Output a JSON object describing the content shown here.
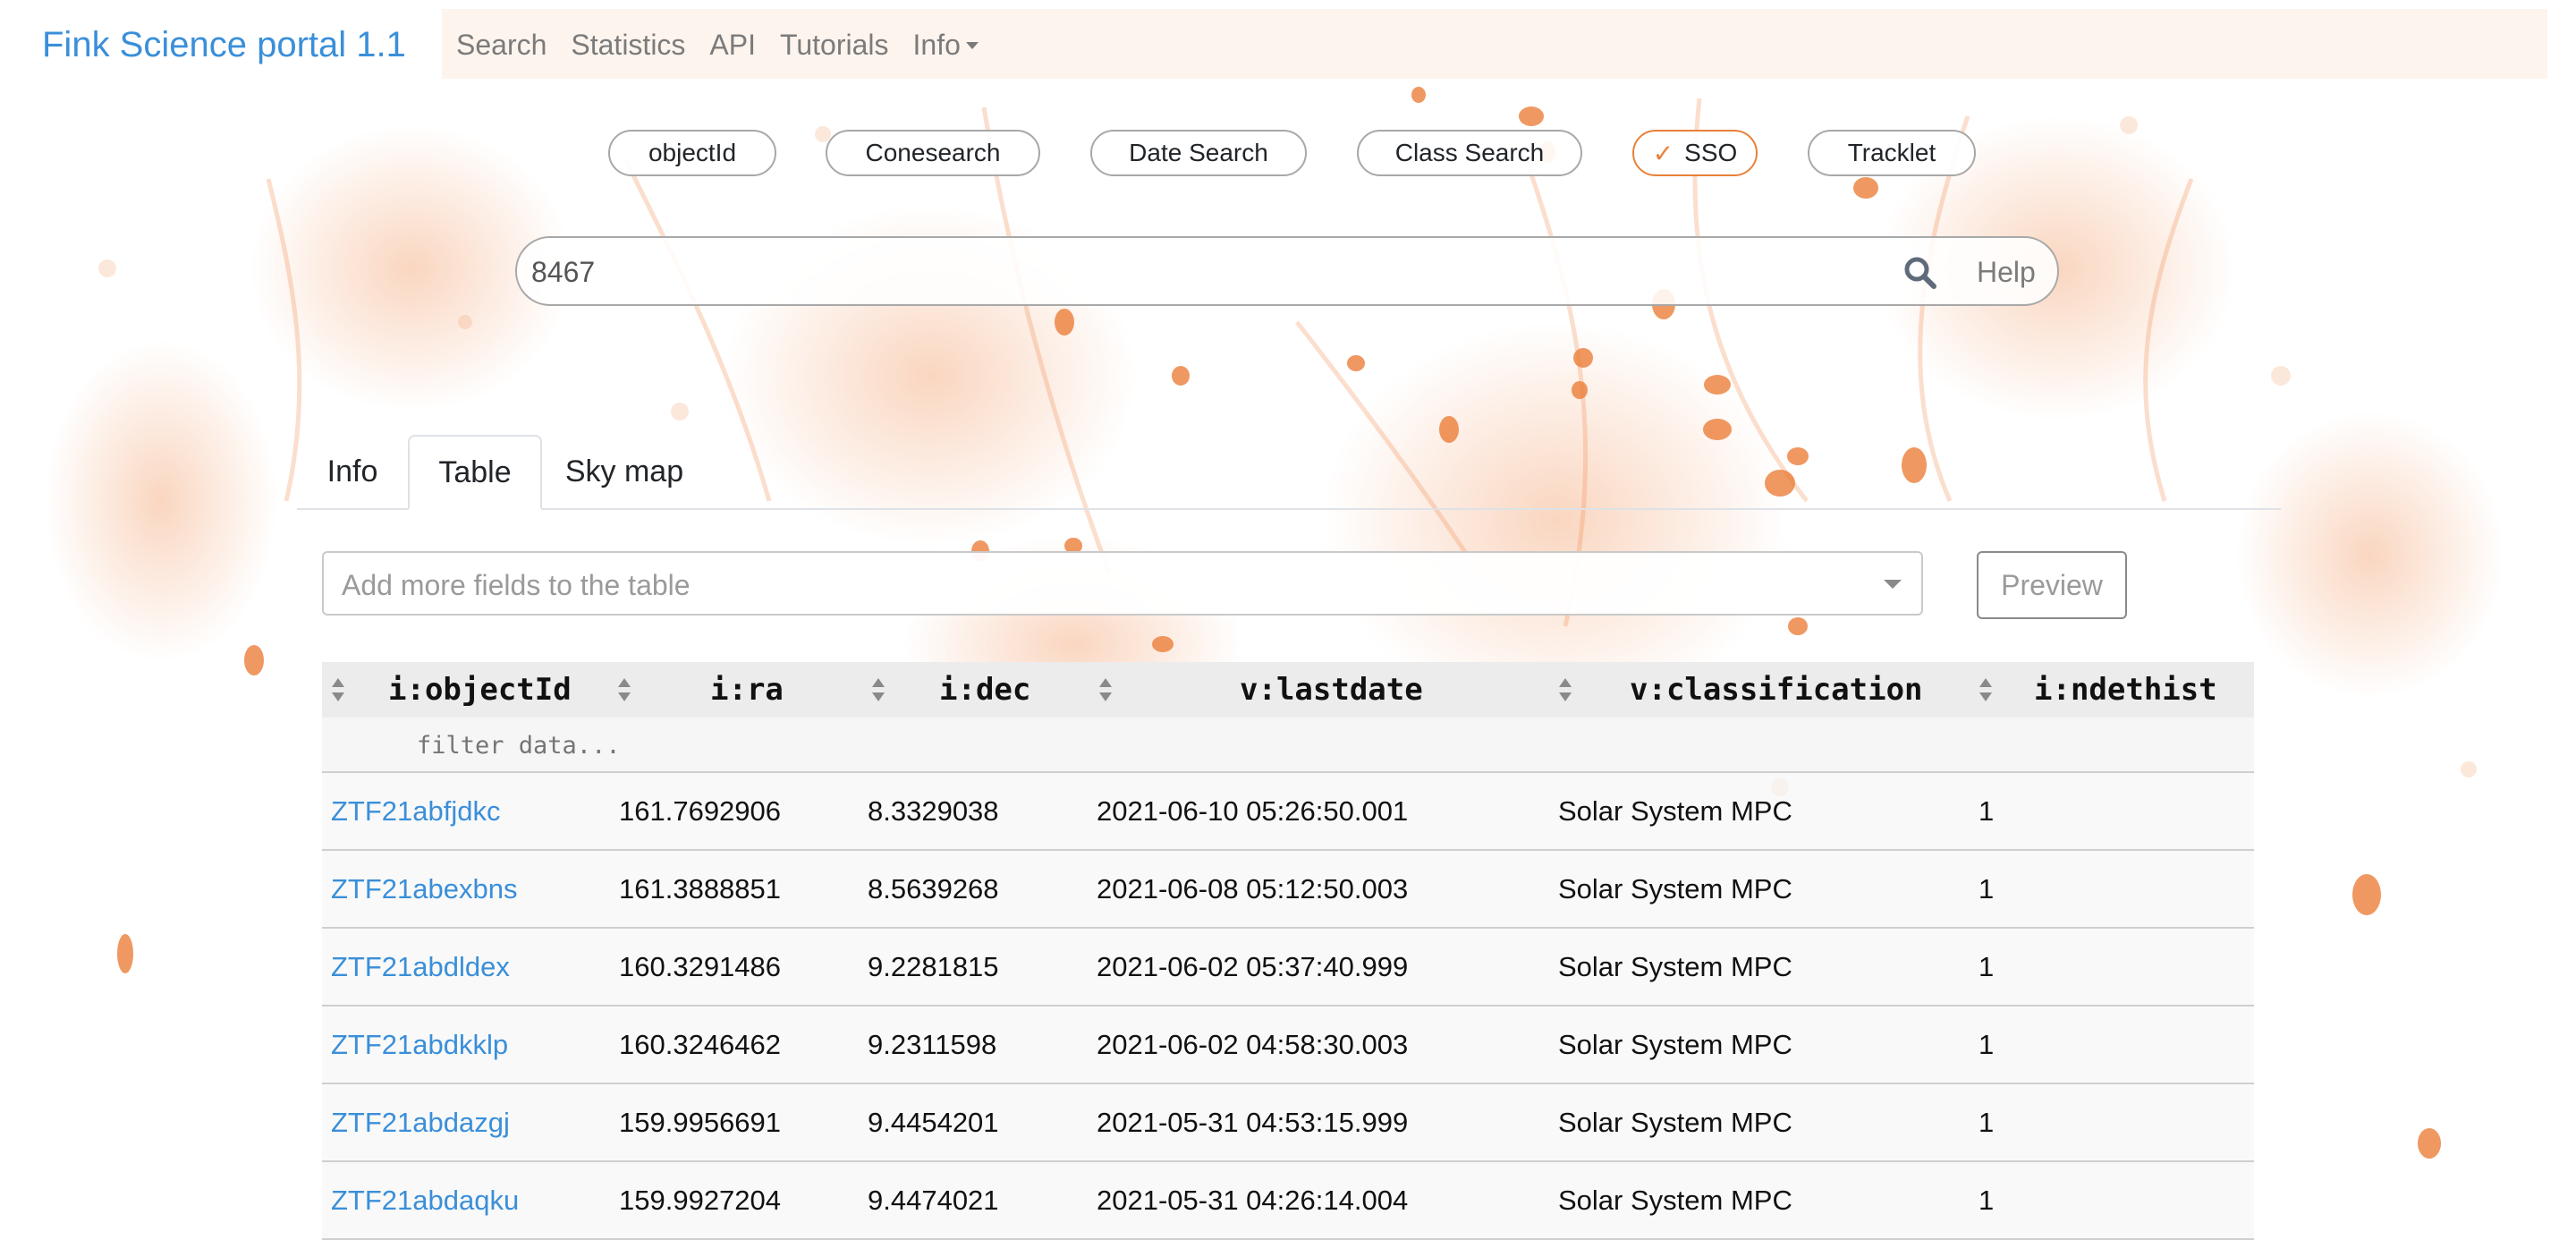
{
  "navbar": {
    "brand": "Fink Science portal 1.1",
    "links": [
      {
        "label": "Search"
      },
      {
        "label": "Statistics"
      },
      {
        "label": "API"
      },
      {
        "label": "Tutorials"
      },
      {
        "label": "Info",
        "has_dropdown": true
      }
    ]
  },
  "search_modes": [
    {
      "label": "objectId",
      "active": false
    },
    {
      "label": "Conesearch",
      "active": false
    },
    {
      "label": "Date Search",
      "active": false
    },
    {
      "label": "Class Search",
      "active": false
    },
    {
      "label": "SSO",
      "active": true
    },
    {
      "label": "Tracklet",
      "active": false
    }
  ],
  "search": {
    "value": "8467",
    "help_label": "Help"
  },
  "tabs": [
    {
      "label": "Info",
      "active": false
    },
    {
      "label": "Table",
      "active": true
    },
    {
      "label": "Sky map",
      "active": false
    }
  ],
  "field_select": {
    "placeholder": "Add more fields to the table"
  },
  "preview_label": "Preview",
  "table": {
    "columns": [
      "i:objectId",
      "i:ra",
      "i:dec",
      "v:lastdate",
      "v:classification",
      "i:ndethist"
    ],
    "filter_placeholder": "filter data...",
    "rows": [
      [
        "ZTF21abfjdkc",
        "161.7692906",
        "8.3329038",
        "2021-06-10 05:26:50.001",
        "Solar System MPC",
        "1"
      ],
      [
        "ZTF21abexbns",
        "161.3888851",
        "8.5639268",
        "2021-06-08 05:12:50.003",
        "Solar System MPC",
        "1"
      ],
      [
        "ZTF21abdldex",
        "160.3291486",
        "9.2281815",
        "2021-06-02 05:37:40.999",
        "Solar System MPC",
        "1"
      ],
      [
        "ZTF21abdkklp",
        "160.3246462",
        "9.2311598",
        "2021-06-02 04:58:30.003",
        "Solar System MPC",
        "1"
      ],
      [
        "ZTF21abdazgj",
        "159.9956691",
        "9.4454201",
        "2021-05-31 04:53:15.999",
        "Solar System MPC",
        "1"
      ],
      [
        "ZTF21abdaqku",
        "159.9927204",
        "9.4474021",
        "2021-05-31 04:26:14.004",
        "Solar System MPC",
        "1"
      ]
    ]
  },
  "colors": {
    "accent": "#e8813a",
    "link": "#3a8fd9",
    "nav_text": "#7b7b7b"
  }
}
